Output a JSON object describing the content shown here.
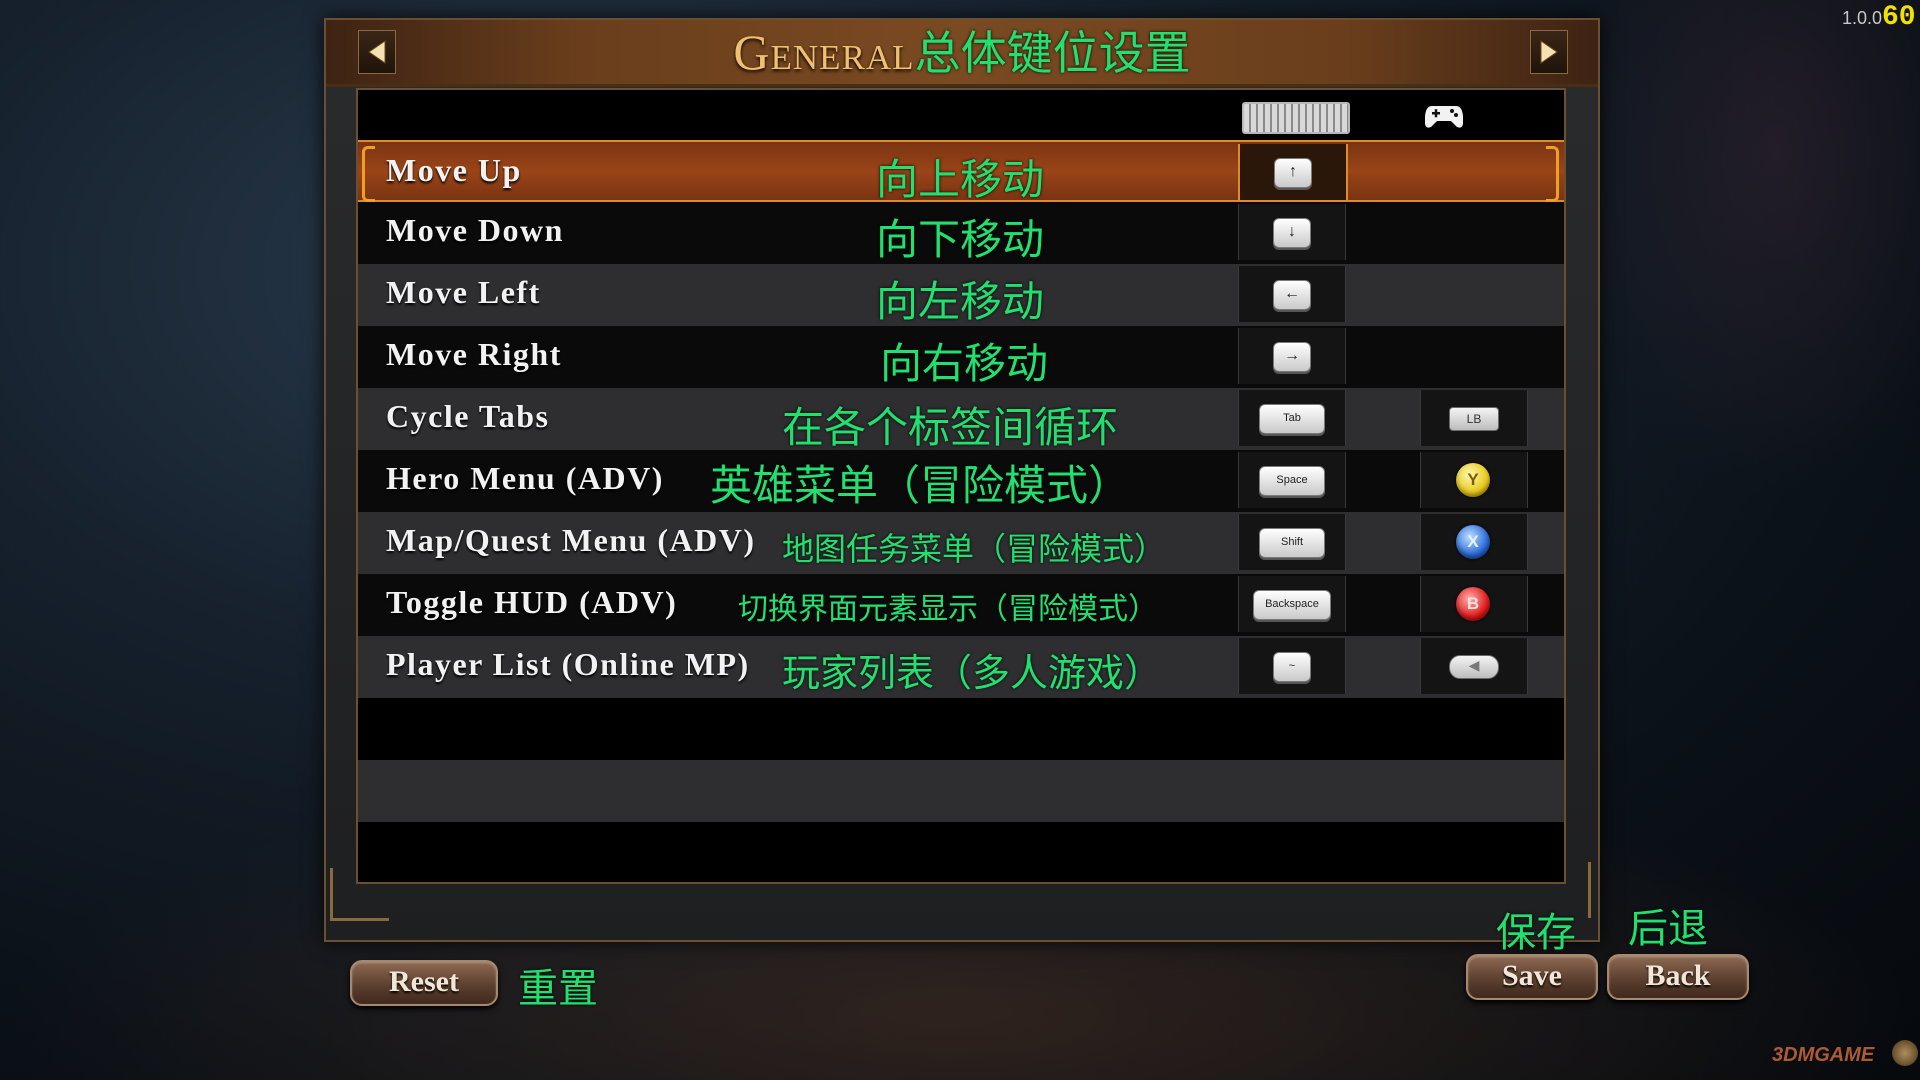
{
  "hud": {
    "version": "1.0.0",
    "fps": "60",
    "watermark": "3DMGAME"
  },
  "header": {
    "title_en": "General",
    "title_cn": "总体键位设置",
    "prev_icon": "arrow-left-icon",
    "next_icon": "arrow-right-icon"
  },
  "columns": {
    "keyboard_icon": "keyboard-icon",
    "gamepad_icon": "gamepad-icon"
  },
  "rows": [
    {
      "action": "Move Up",
      "cn": "向上移动",
      "key": "↑",
      "pad": "",
      "selected": true
    },
    {
      "action": "Move Down",
      "cn": "向下移动",
      "key": "↓",
      "pad": ""
    },
    {
      "action": "Move Left",
      "cn": "向左移动",
      "key": "←",
      "pad": ""
    },
    {
      "action": "Move Right",
      "cn": "向右移动",
      "key": "→",
      "pad": ""
    },
    {
      "action": "Cycle Tabs",
      "cn": "在各个标签间循环",
      "key": "Tab",
      "pad": "LB"
    },
    {
      "action": "Hero Menu (ADV)",
      "cn": "英雄菜单（冒险模式）",
      "key": "Space",
      "pad": "Y"
    },
    {
      "action": "Map/Quest Menu (ADV)",
      "cn": "地图任务菜单（冒险模式）",
      "key": "Shift",
      "pad": "X"
    },
    {
      "action": "Toggle HUD (ADV)",
      "cn": "切换界面元素显示（冒险模式）",
      "key": "Backspace",
      "pad": "B"
    },
    {
      "action": "Player List (Online MP)",
      "cn": "玩家列表（多人游戏）",
      "key": "~",
      "pad": "◀"
    }
  ],
  "buttons": {
    "reset": "Reset",
    "reset_cn": "重置",
    "save": "Save",
    "save_cn": "保存",
    "back": "Back",
    "back_cn": "后退"
  },
  "colors": {
    "accent_green": "#22e070",
    "selected_row": "#9a4418",
    "frame": "#6a5030"
  }
}
